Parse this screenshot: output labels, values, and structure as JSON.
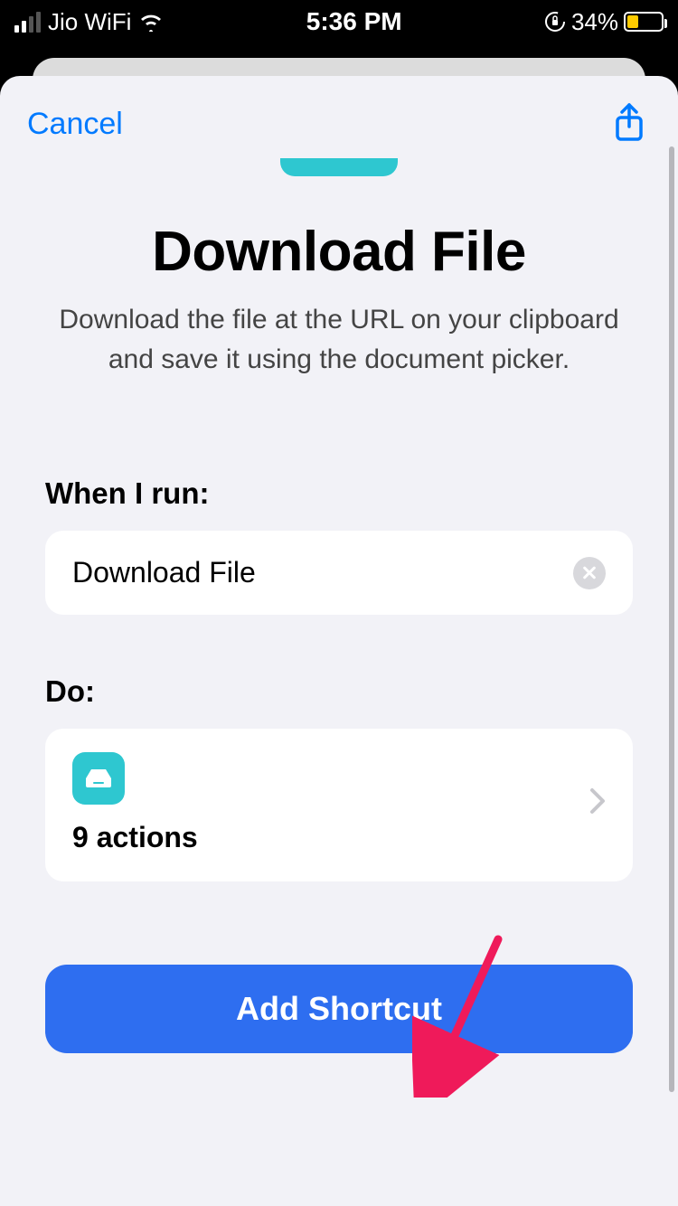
{
  "status": {
    "carrier": "Jio WiFi",
    "time": "5:36 PM",
    "battery_pct": "34%",
    "battery_level_width": "34%"
  },
  "nav": {
    "cancel": "Cancel"
  },
  "header": {
    "title": "Download File",
    "subtitle": "Download the file at the URL on your clipboard and save it using the document picker."
  },
  "sections": {
    "when_label": "When I run:",
    "when_value": "Download File",
    "do_label": "Do:",
    "actions_count": "9 actions"
  },
  "primary_button": "Add Shortcut"
}
